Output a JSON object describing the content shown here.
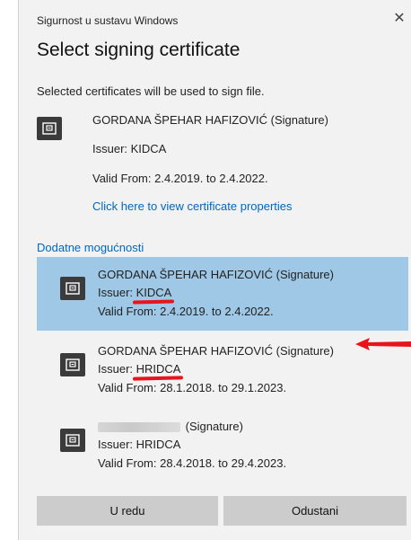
{
  "window": {
    "title": "Sigurnost u sustavu Windows",
    "heading": "Select signing certificate",
    "subtitle": "Selected certificates will be used to sign file."
  },
  "primary_certificate": {
    "name": "GORDANA ŠPEHAR HAFIZOVIĆ (Signature)",
    "issuer": "Issuer: KIDCA",
    "valid": "Valid From: 2.4.2019. to 2.4.2022.",
    "link": "Click here to view certificate properties",
    "icon": "certificate-icon"
  },
  "more_options": {
    "label": "Dodatne mogućnosti",
    "items": [
      {
        "name": "GORDANA ŠPEHAR HAFIZOVIĆ (Signature)",
        "issuer_label": "Issuer: ",
        "issuer_value": "KIDCA",
        "valid": "Valid From: 2.4.2019. to 2.4.2022.",
        "selected": true
      },
      {
        "name": "GORDANA ŠPEHAR HAFIZOVIĆ (Signature)",
        "issuer_label": "Issuer: ",
        "issuer_value": "HRIDCA",
        "valid": "Valid From: 28.1.2018. to 29.1.2023.",
        "selected": false
      },
      {
        "name_suffix": "(Signature)",
        "issuer_label": "Issuer: ",
        "issuer_value": "HRIDCA",
        "valid": "Valid From: 28.4.2018. to 29.4.2023.",
        "selected": false
      }
    ]
  },
  "buttons": {
    "ok": "U redu",
    "cancel": "Odustani"
  },
  "colors": {
    "selected_bg": "#9ec8e6",
    "link": "#0067c0",
    "annotation": "#e8141c",
    "button_bg": "#cccccc",
    "dialog_bg": "#f2f2f2"
  }
}
